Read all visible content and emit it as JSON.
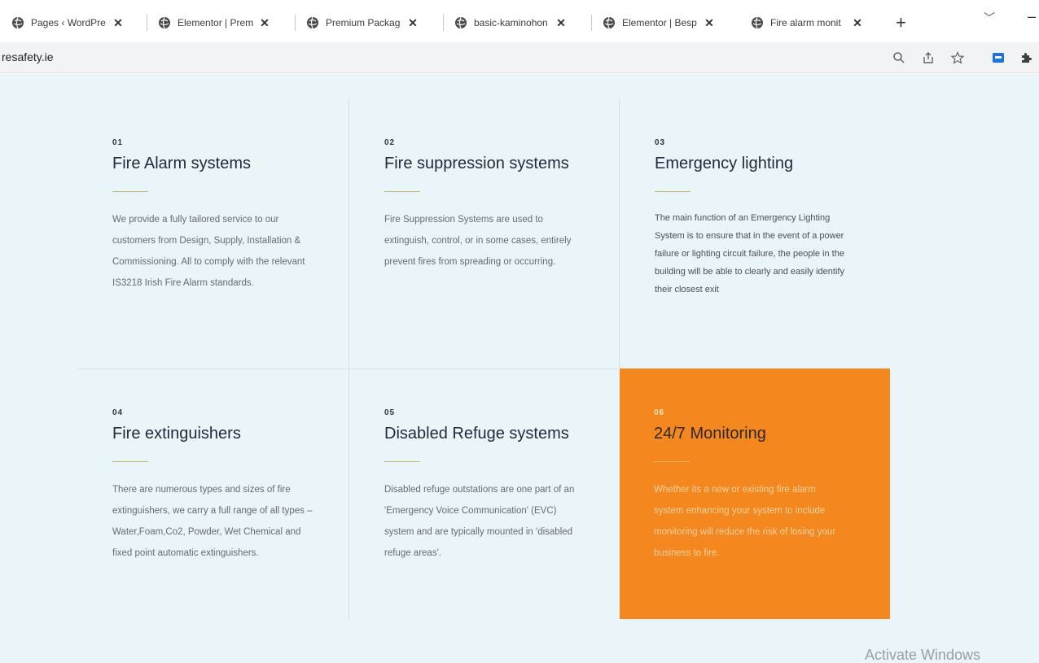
{
  "browser": {
    "tabs": [
      {
        "label": "Pages ‹ WordPre",
        "active": false
      },
      {
        "label": "Elementor | Prem",
        "active": false
      },
      {
        "label": "Premium Packag",
        "active": false
      },
      {
        "label": "basic-kaminohon",
        "active": false
      },
      {
        "label": "Elementor | Besp",
        "active": false
      },
      {
        "label": "Fire alarm monit",
        "active": true
      }
    ],
    "new_tab_icon": "+",
    "url": "resafety.ie"
  },
  "services": [
    {
      "num": "01",
      "title": "Fire Alarm systems",
      "desc": "We provide a fully tailored service to our customers from Design, Supply, Installation & Commissioning. All to comply with the relevant IS3218 Irish Fire Alarm standards."
    },
    {
      "num": "02",
      "title": "Fire suppression systems",
      "desc": "Fire Suppression Systems are used to extinguish, control, or in some cases, entirely prevent fires from spreading or occurring."
    },
    {
      "num": "03",
      "title": "Emergency lighting",
      "desc": "The main function of an Emergency Lighting System is to ensure that in the event of a power failure or lighting circuit failure, the people in the building will be able to clearly and easily identify their closest exit"
    },
    {
      "num": "04",
      "title": "Fire extinguishers",
      "desc": "There are numerous types and sizes of fire extinguishers, we carry a full range of all types – Water,Foam,Co2, Powder, Wet Chemical and fixed point automatic extinguishers."
    },
    {
      "num": "05",
      "title": "Disabled Refuge systems",
      "desc": "Disabled refuge outstations are one part of an 'Emergency Voice Communication' (EVC) system and are typically mounted in 'disabled refuge areas'."
    },
    {
      "num": "06",
      "title": "24/7 Monitoring",
      "desc": "Whether its a new or existing fire alarm system enhancing your system to include monitoring will reduce the risk of losing your business to fire."
    }
  ],
  "watermark": "Activate Windows",
  "colors": {
    "accent": "#f4871e",
    "page_bg": "#eaf5f9"
  }
}
